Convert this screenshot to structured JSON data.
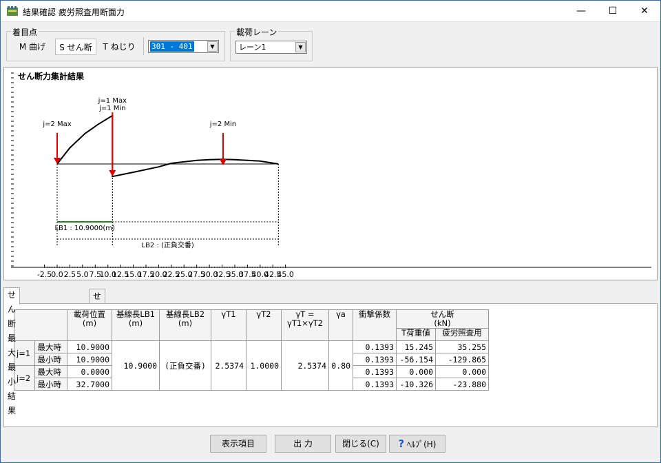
{
  "window": {
    "title": "結果確認 疲労照査用断面力",
    "minimize_glyph": "—",
    "maximize_glyph": "☐",
    "close_glyph": "✕"
  },
  "focus": {
    "group_label": "着目点",
    "buttons": [
      "M 曲げ",
      "S せん断",
      "T ねじり"
    ],
    "selected_button": "S せん断",
    "member_select": "301 - 401"
  },
  "lane": {
    "group_label": "載荷レーン",
    "select": "レーン1"
  },
  "chart_data": {
    "type": "line",
    "title": "せん断力集計結果",
    "xlim": [
      -2.5,
      45.0
    ],
    "x_ticks": [
      "-2.5",
      "0.0",
      "2.5",
      "5.0",
      "7.5",
      "10.0",
      "12.5",
      "15.0",
      "17.5",
      "20.0",
      "22.5",
      "25.0",
      "27.5",
      "30.0",
      "32.5",
      "35.0",
      "37.5",
      "40.0",
      "42.5",
      "45.0"
    ],
    "influence_line": {
      "x": [
        0,
        2.5,
        5.5,
        8.0,
        10.9,
        10.9,
        15,
        20,
        22.5,
        27.5,
        30,
        32.5,
        35,
        40,
        43.6
      ],
      "y": [
        0,
        0.45,
        0.85,
        1.1,
        1.35,
        -0.35,
        -0.23,
        -0.08,
        0.02,
        0.1,
        0.12,
        0.13,
        0.12,
        0.08,
        0.0
      ]
    },
    "markers": [
      {
        "label": "j=2 Max",
        "x": 0.0
      },
      {
        "label": "j=1 Max",
        "x": 10.9
      },
      {
        "label": "j=1 Min",
        "x": 10.9
      },
      {
        "label": "j=2 Min",
        "x": 32.7
      }
    ],
    "span_end": 43.6,
    "lb1_label": "LB1 : 10.9000(m)",
    "lb2_label": "LB2 : (正負交番)"
  },
  "tabs": [
    "せん断最大最小結果",
    "せん断着目時曲げ"
  ],
  "table": {
    "headers": {
      "load_pos": "載荷位置\n(m)",
      "lb1": "基線長LB1\n(m)",
      "lb2": "基線長LB2\n(m)",
      "gt1": "γT1",
      "gt2": "γT2",
      "gt": "γT =\nγT1×γT2",
      "ga": "γa",
      "impact": "衝撃係数",
      "shear": "せん断\n(kN)",
      "t_load": "T荷重値",
      "fatigue": "疲労照査用"
    },
    "merged": {
      "lb1": "10.9000",
      "lb2": "(正負交番)",
      "gt1": "2.5374",
      "gt2": "1.0000",
      "gt": "2.5374",
      "ga": "0.80"
    },
    "groups": [
      {
        "name": "j=1",
        "rows": [
          {
            "label": "最大時",
            "pos": "10.9000",
            "impact": "0.1393",
            "t_load": "15.245",
            "fatigue": "35.255"
          },
          {
            "label": "最小時",
            "pos": "10.9000",
            "impact": "0.1393",
            "t_load": "-56.154",
            "fatigue": "-129.865"
          }
        ]
      },
      {
        "name": "j=2",
        "rows": [
          {
            "label": "最大時",
            "pos": "0.0000",
            "impact": "0.1393",
            "t_load": "0.000",
            "fatigue": "0.000"
          },
          {
            "label": "最小時",
            "pos": "32.7000",
            "impact": "0.1393",
            "t_load": "-10.326",
            "fatigue": "-23.880"
          }
        ]
      }
    ]
  },
  "footer": {
    "display_items": "表示項目",
    "output": "出 力",
    "close": "閉じる(C)",
    "help": "ﾍﾙﾌﾟ(H)"
  }
}
